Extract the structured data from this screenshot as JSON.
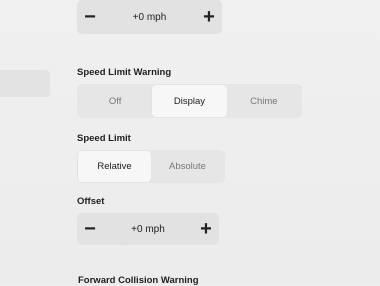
{
  "top_stepper": {
    "minus": "−",
    "value": "+0 mph",
    "plus": "+"
  },
  "speed_limit_warning": {
    "label": "Speed Limit Warning",
    "options": [
      "Off",
      "Display",
      "Chime"
    ],
    "selected": "Display"
  },
  "speed_limit": {
    "label": "Speed Limit",
    "options": [
      "Relative",
      "Absolute"
    ],
    "selected": "Relative"
  },
  "offset": {
    "label": "Offset",
    "minus": "−",
    "value": "+0 mph",
    "plus": "+"
  },
  "forward_collision_warning": {
    "label": "Forward Collision Warning"
  },
  "colors": {
    "background": "#efefef",
    "control_bg": "#e2e2e2",
    "active_segment": "#f7f7f7",
    "text": "#222222",
    "inactive_text": "#777777"
  }
}
